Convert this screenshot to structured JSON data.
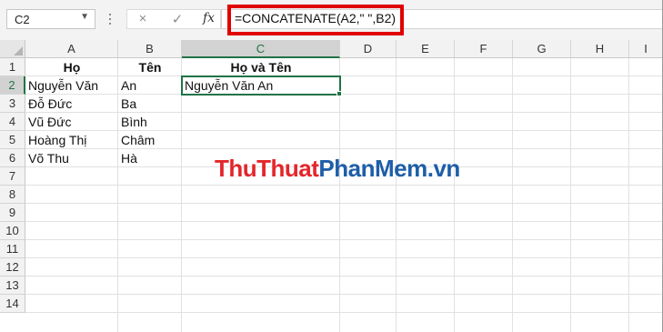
{
  "name_box": {
    "value": "C2"
  },
  "formula_bar": {
    "cancel_icon": "×",
    "enter_icon": "✓",
    "fx_label": "fx",
    "formula": "=CONCATENATE(A2,\" \",B2)"
  },
  "columns": [
    "A",
    "B",
    "C",
    "D",
    "E",
    "F",
    "G",
    "H",
    "I"
  ],
  "selected_column": "C",
  "rows": [
    "1",
    "2",
    "3",
    "4",
    "5",
    "6",
    "7",
    "8",
    "9",
    "10",
    "11",
    "12",
    "13",
    "14"
  ],
  "selected_row": "2",
  "headers": {
    "a1": "Họ",
    "b1": "Tên",
    "c1": "Họ và Tên"
  },
  "data_rows": [
    {
      "a": "Nguyễn Văn",
      "b": "An",
      "c": "Nguyễn Văn An"
    },
    {
      "a": "Đỗ Đức",
      "b": "Ba",
      "c": ""
    },
    {
      "a": "Vũ Đức",
      "b": "Bình",
      "c": ""
    },
    {
      "a": "Hoàng Thị",
      "b": "Châm",
      "c": ""
    },
    {
      "a": "Võ Thu",
      "b": "Hà",
      "c": ""
    }
  ],
  "watermark": {
    "part1": "ThuThuat",
    "part2": "PhanMem",
    "part3": ".vn"
  },
  "colors": {
    "accent": "#217346",
    "highlight": "#e00000",
    "wm_red": "#e3262b",
    "wm_blue": "#1e5ea8"
  }
}
